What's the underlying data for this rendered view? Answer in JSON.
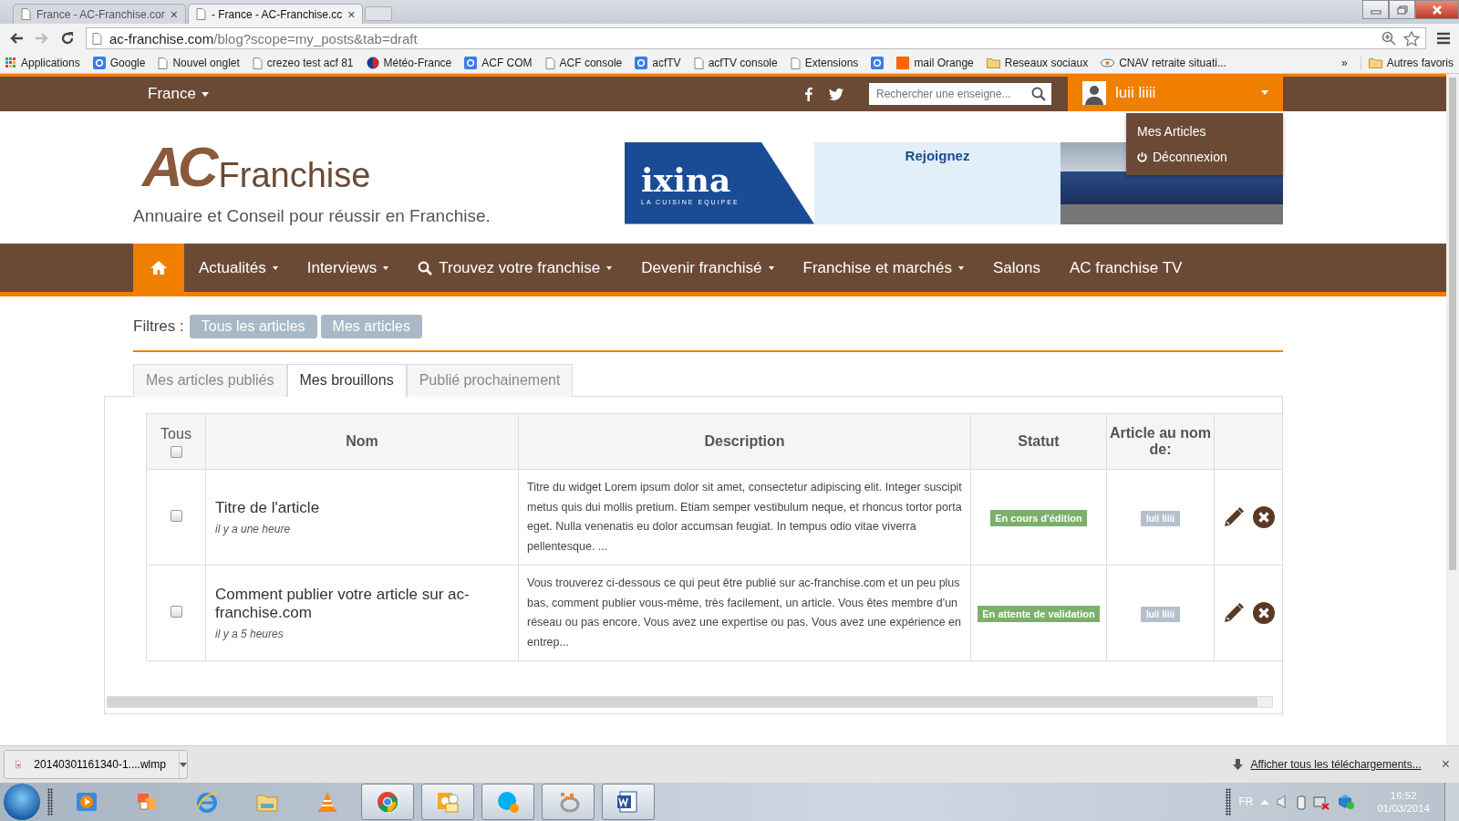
{
  "browser": {
    "tabs": [
      {
        "title": "France - AC-Franchise.cor",
        "selected": false
      },
      {
        "title": "- France - AC-Franchise.cc",
        "selected": true
      }
    ],
    "close_glyph": "×",
    "url": {
      "domain": "ac-franchise.com",
      "path": "/blog?scope=my_posts&tab=draft"
    },
    "bookmarks": [
      {
        "label": "Applications",
        "kind": "apps"
      },
      {
        "label": "Google",
        "kind": "g"
      },
      {
        "label": "Nouvel onglet",
        "kind": "page"
      },
      {
        "label": "crezeo test acf 81",
        "kind": "page"
      },
      {
        "label": "Météo-France",
        "kind": "meteo"
      },
      {
        "label": "ACF COM",
        "kind": "g"
      },
      {
        "label": "ACF console",
        "kind": "page"
      },
      {
        "label": "acfTV",
        "kind": "g"
      },
      {
        "label": "acfTV console",
        "kind": "page"
      },
      {
        "label": "Extensions",
        "kind": "page"
      },
      {
        "kind": "g"
      },
      {
        "label": "mail Orange",
        "kind": "orange"
      },
      {
        "label": "Reseaux sociaux",
        "kind": "folder"
      },
      {
        "label": "CNAV retraite situati...",
        "kind": "cnav"
      }
    ],
    "overflow": "»",
    "other_favorites": "Autres favoris"
  },
  "site": {
    "region": "France",
    "search": {
      "placeholder": "Rechercher une enseigne..."
    },
    "user": {
      "name": "luii liiii"
    },
    "user_menu": [
      {
        "label": "Mes Articles",
        "kind": "link"
      },
      {
        "label": "Déconnexion",
        "kind": "power"
      }
    ],
    "logo": {
      "mark": "AC",
      "name": "Franchise"
    },
    "tagline": "Annuaire et Conseil pour réussir en Franchise.",
    "ad": {
      "brand": "ixina",
      "slogan": "LA CUISINE EQUIPEE",
      "headline": "Rejoignez"
    },
    "nav": [
      {
        "kind": "home",
        "selected": true
      },
      {
        "label": "Actualités",
        "kind": "dropdown",
        "selected": false
      },
      {
        "label": "Interviews",
        "kind": "dropdown",
        "selected": false
      },
      {
        "label": "Trouvez votre franchise",
        "kind": "search",
        "selected": false
      },
      {
        "label": "Devenir franchisé",
        "kind": "dropdown",
        "selected": false
      },
      {
        "label": "Franchise et marchés",
        "kind": "dropdown",
        "selected": false
      },
      {
        "label": "Salons",
        "kind": "link",
        "selected": false
      },
      {
        "label": "AC franchise TV",
        "kind": "link",
        "selected": false
      }
    ],
    "filters": {
      "label": "Filtres :",
      "buttons": [
        "Tous les articles",
        "Mes articles"
      ]
    },
    "content_tabs": [
      {
        "label": "Mes articles publiés",
        "selected": false
      },
      {
        "label": "Mes brouillons",
        "selected": true
      },
      {
        "label": "Publié prochainement",
        "selected": false
      }
    ],
    "table": {
      "select_all": {
        "label": "Tous",
        "checked": false
      },
      "columns": [
        "Nom",
        "Description",
        "Statut",
        "Article au nom de:"
      ],
      "rows": [
        {
          "checked": false,
          "title": "Titre de l'article",
          "time": "il y a une heure",
          "description": "Titre du widget Lorem ipsum dolor sit amet, consectetur adipiscing elit. Integer suscipit metus quis dui mollis pretium. Etiam semper vestibulum neque, et rhoncus tortor porta eget. Nulla venenatis eu dolor accumsan feugiat. In tempus odio vitae viverra pellentesque. ...",
          "status": "En cours d'édition",
          "author": "luii liiii"
        },
        {
          "checked": false,
          "title": "Comment publier votre article sur ac-franchise.com",
          "time": "il y a 5 heures",
          "description": "Vous trouverez ci-dessous ce qui peut être publié sur ac-franchise.com et un peu plus bas, comment publier vous-même, très facilement, un article. Vous êtes membre d'un réseau ou pas encore. Vous avez une expertise ou pas. Vous avez une expérience en entrep...",
          "status": "En attente de validation",
          "author": "luii liiii"
        }
      ]
    }
  },
  "download_bar": {
    "file": "20140301161340-1....wlmp",
    "show_all": "Afficher tous les téléchargements...",
    "close": "×"
  },
  "taskbar": {
    "apps": [
      {
        "kind": "media",
        "running": false
      },
      {
        "kind": "photos",
        "running": false
      },
      {
        "kind": "ie",
        "running": false
      },
      {
        "kind": "explorer",
        "running": false
      },
      {
        "kind": "vlc",
        "running": false
      },
      {
        "kind": "chrome",
        "running": true
      },
      {
        "kind": "outlook",
        "running": true
      },
      {
        "kind": "skype",
        "running": true
      },
      {
        "kind": "network",
        "running": true
      },
      {
        "kind": "word",
        "running": true
      }
    ],
    "tray": {
      "language": "FR",
      "time": "16:52",
      "date": "01/03/2014"
    }
  }
}
